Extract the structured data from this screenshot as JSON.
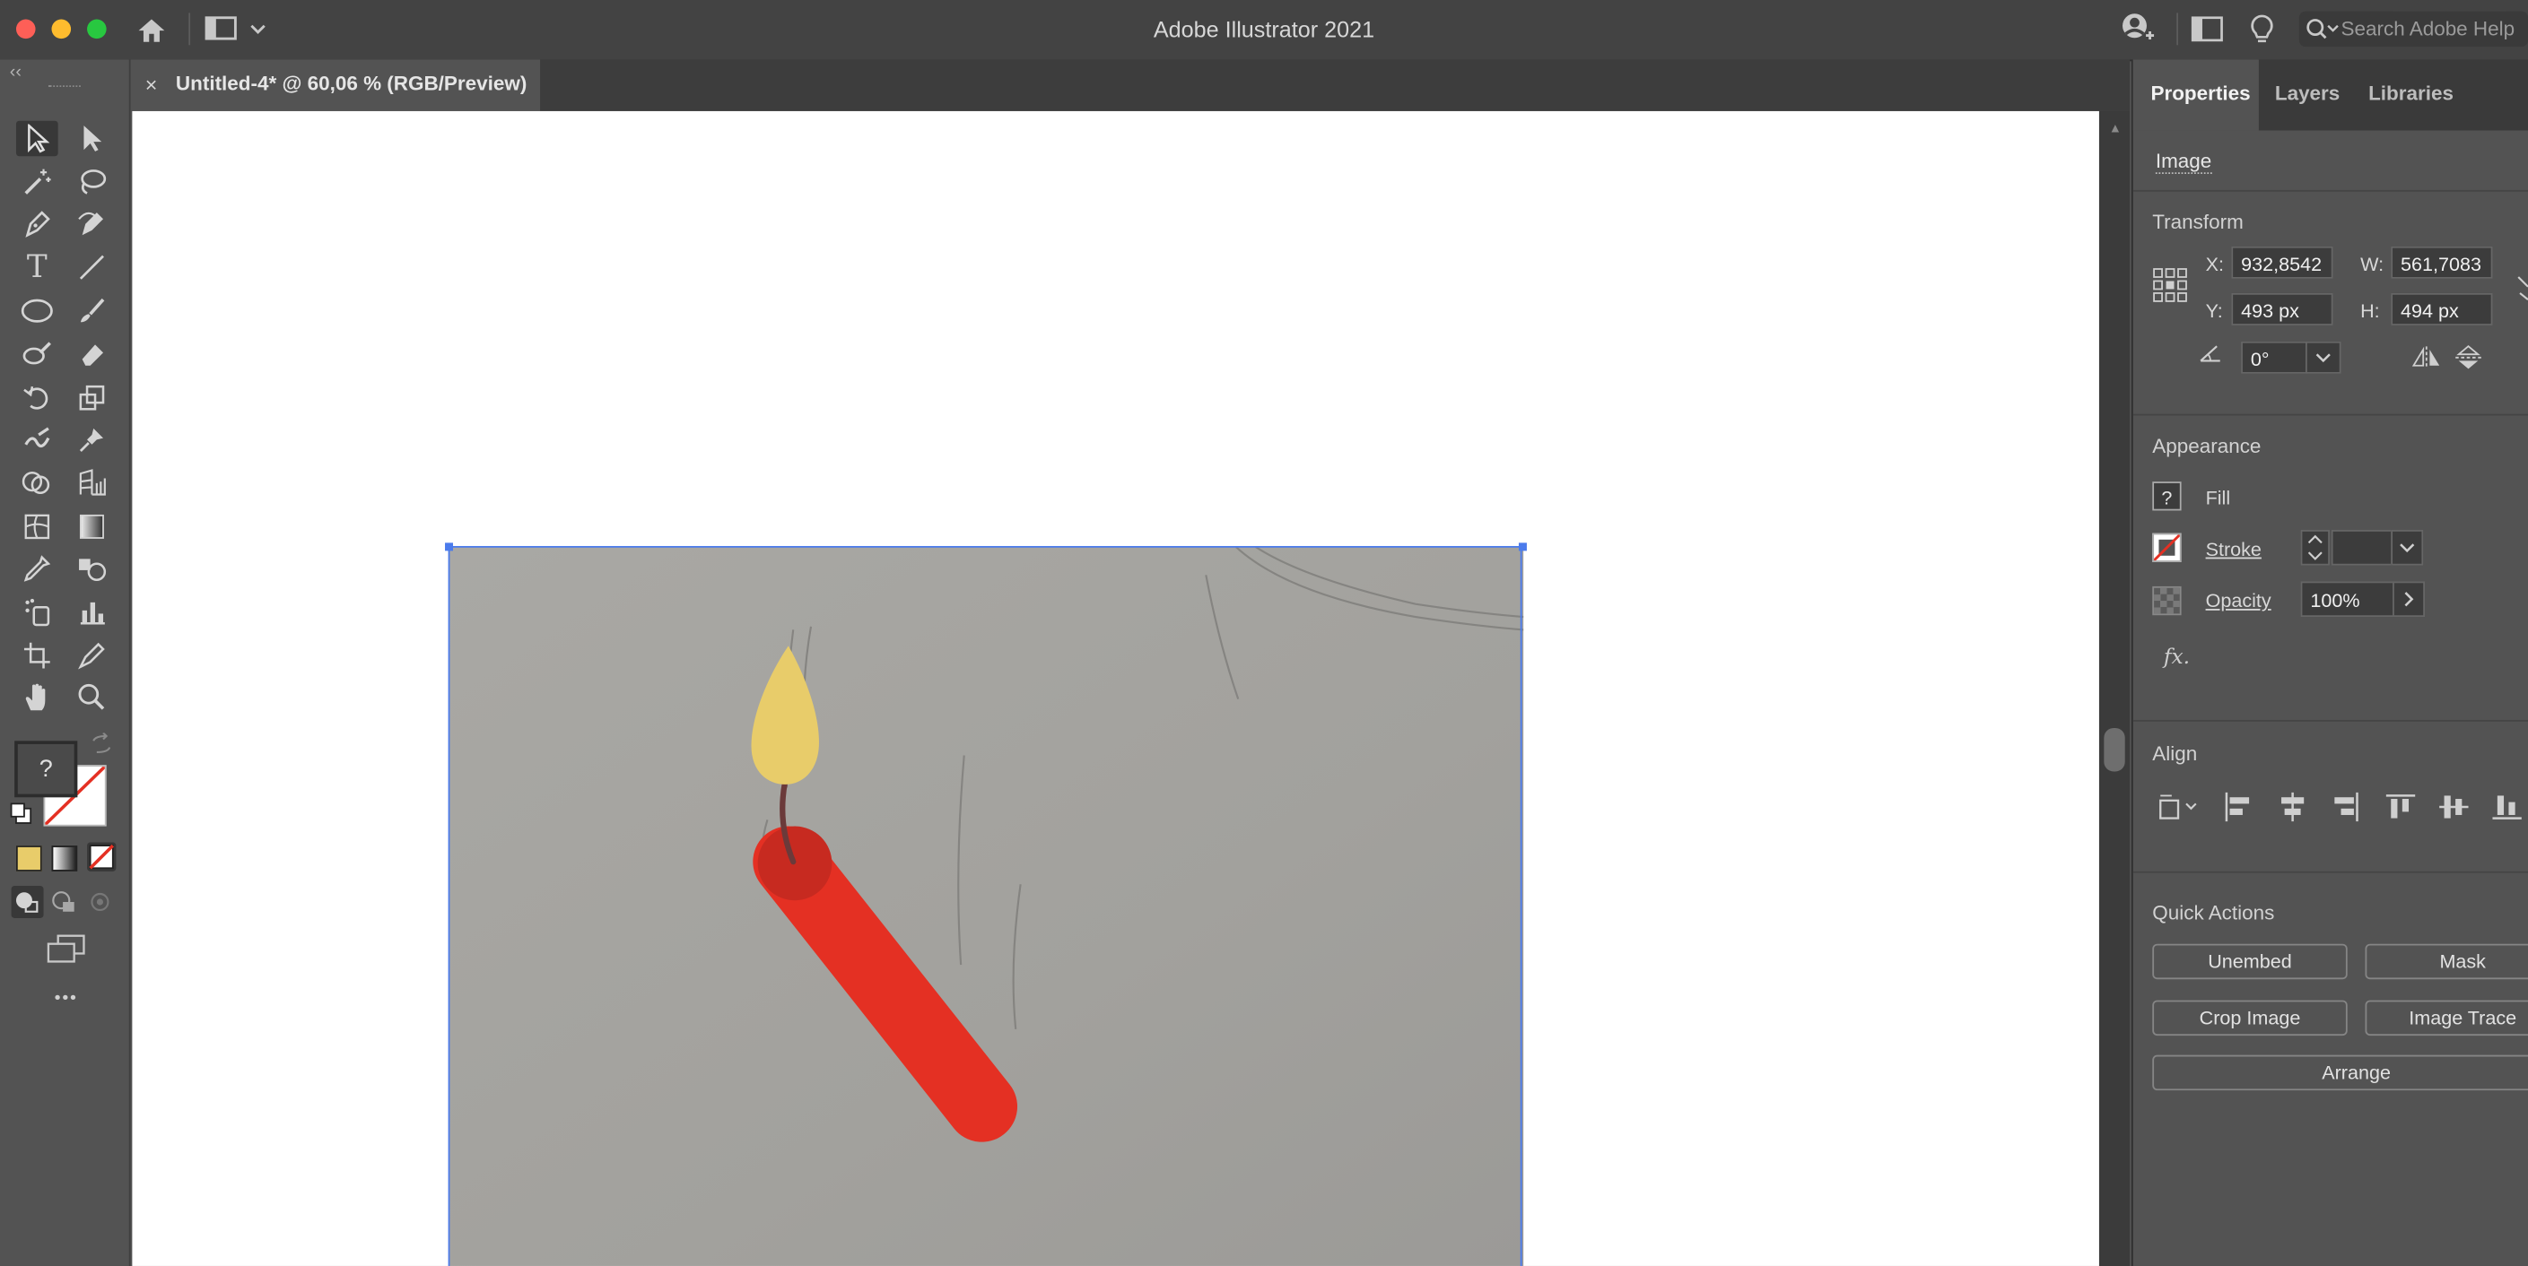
{
  "window": {
    "title": "Adobe Illustrator 2021",
    "search_placeholder": "Search Adobe Help",
    "traffic_lights": {
      "close": "#fe5f57",
      "minimize": "#febc2e",
      "maximize": "#28c840"
    }
  },
  "document": {
    "tab_label": "Untitled-4* @ 60,06 % (RGB/Preview)",
    "close_glyph": "×"
  },
  "tools": {
    "fill_unknown_glyph": "?",
    "more_glyph": "•••",
    "icons": [
      "selection-tool",
      "direct-selection-tool",
      "magic-wand-tool",
      "lasso-tool",
      "pen-tool",
      "curvature-tool",
      "type-tool",
      "line-segment-tool",
      "ellipse-tool",
      "paintbrush-tool",
      "shaper-tool",
      "eraser-tool",
      "rotate-tool",
      "scale-tool",
      "warp-tool",
      "pin-tool",
      "shape-builder-tool",
      "perspective-grid-tool",
      "mesh-tool",
      "gradient-tool",
      "eyedropper-tool",
      "blend-tool",
      "symbol-sprayer-tool",
      "column-graph-tool",
      "artboard-tool",
      "slice-tool",
      "hand-tool",
      "zoom-tool"
    ]
  },
  "properties": {
    "tabs": [
      "Properties",
      "Layers",
      "Libraries"
    ],
    "object_type": "Image",
    "transform": {
      "title": "Transform",
      "x_label": "X:",
      "x_value": "932,8542",
      "y_label": "Y:",
      "y_value": "493 px",
      "w_label": "W:",
      "w_value": "561,7083",
      "h_label": "H:",
      "h_value": "494 px",
      "angle_value": "0°"
    },
    "appearance": {
      "title": "Appearance",
      "fill_label": "Fill",
      "fill_glyph": "?",
      "stroke_label": "Stroke",
      "opacity_label": "Opacity",
      "opacity_value": "100%",
      "fx_label": "fx."
    },
    "align": {
      "title": "Align"
    },
    "quick_actions": {
      "title": "Quick Actions",
      "unembed": "Unembed",
      "mask": "Mask",
      "crop_image": "Crop Image",
      "image_trace": "Image Trace",
      "arrange": "Arrange"
    }
  },
  "colors": {
    "candle_body": "#e43023",
    "candle_top": "#c72a20",
    "flame": "#e8cc6a",
    "wick": "#6b3a3a",
    "selection": "#4b7bec",
    "paper": "#a9a8a4"
  }
}
